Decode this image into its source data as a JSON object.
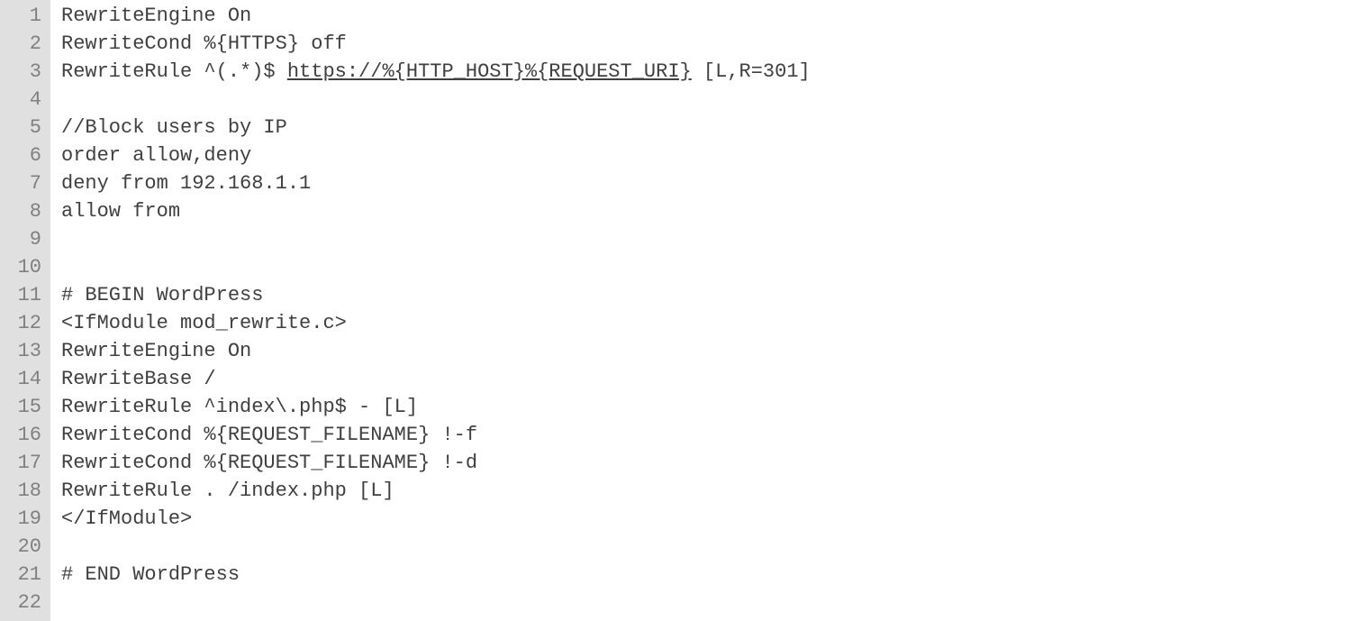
{
  "gutter": {
    "start": 1,
    "end": 22
  },
  "code": {
    "lines": [
      {
        "segments": [
          {
            "text": "RewriteEngine On"
          }
        ]
      },
      {
        "segments": [
          {
            "text": "RewriteCond %{HTTPS} off"
          }
        ]
      },
      {
        "segments": [
          {
            "text": "RewriteRule ^(.*)$ "
          },
          {
            "text": "https://%{HTTP_HOST}%{REQUEST_URI}",
            "underline": true
          },
          {
            "text": " [L,R=301]"
          }
        ]
      },
      {
        "segments": [
          {
            "text": ""
          }
        ]
      },
      {
        "segments": [
          {
            "text": "//Block users by IP"
          }
        ]
      },
      {
        "segments": [
          {
            "text": "order allow,deny"
          }
        ]
      },
      {
        "segments": [
          {
            "text": "deny from 192.168.1.1"
          }
        ]
      },
      {
        "segments": [
          {
            "text": "allow from"
          }
        ]
      },
      {
        "segments": [
          {
            "text": ""
          }
        ]
      },
      {
        "segments": [
          {
            "text": ""
          }
        ]
      },
      {
        "segments": [
          {
            "text": "# BEGIN WordPress"
          }
        ]
      },
      {
        "segments": [
          {
            "text": "<IfModule mod_rewrite.c>"
          }
        ]
      },
      {
        "segments": [
          {
            "text": "RewriteEngine On"
          }
        ]
      },
      {
        "segments": [
          {
            "text": "RewriteBase /"
          }
        ]
      },
      {
        "segments": [
          {
            "text": "RewriteRule ^index\\.php$ - [L]"
          }
        ]
      },
      {
        "segments": [
          {
            "text": "RewriteCond %{REQUEST_FILENAME} !-f"
          }
        ]
      },
      {
        "segments": [
          {
            "text": "RewriteCond %{REQUEST_FILENAME} !-d"
          }
        ]
      },
      {
        "segments": [
          {
            "text": "RewriteRule . /index.php [L]"
          }
        ]
      },
      {
        "segments": [
          {
            "text": "</IfModule>"
          }
        ]
      },
      {
        "segments": [
          {
            "text": ""
          }
        ]
      },
      {
        "segments": [
          {
            "text": "# END WordPress"
          }
        ]
      },
      {
        "segments": [
          {
            "text": ""
          }
        ]
      }
    ]
  }
}
